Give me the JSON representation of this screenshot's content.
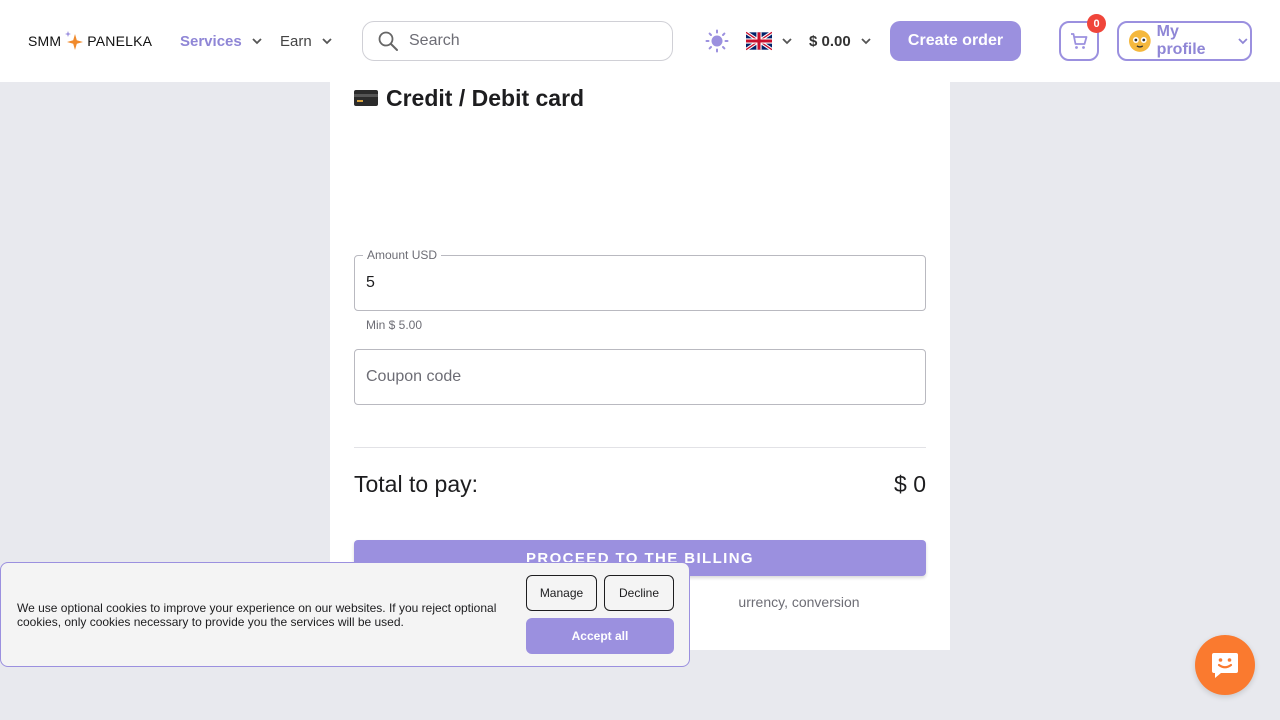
{
  "header": {
    "logo": {
      "part1": "SMM",
      "part2": "PANELKA"
    },
    "nav": [
      {
        "label": "Services",
        "active": true
      },
      {
        "label": "Earn",
        "active": false
      }
    ],
    "search": {
      "placeholder": "Search",
      "value": ""
    },
    "language": {
      "icon": "uk-flag-icon"
    },
    "balance": "$ 0.00",
    "create_order_label": "Create order",
    "cart_count": "0",
    "profile_label": "My profile"
  },
  "payment": {
    "title": "Credit / Debit card",
    "amount": {
      "legend": "Amount USD",
      "value": "5",
      "helper": "Min $ 5.00"
    },
    "coupon": {
      "placeholder": "Coupon code",
      "value": ""
    },
    "total_label": "Total to pay:",
    "total_value": "$ 0",
    "proceed_label": "PROCEED TO THE BILLING",
    "note_visible": "urrency, conversion"
  },
  "cookie_banner": {
    "text": "We use optional cookies to improve your experience on our websites. If you reject optional cookies, only cookies necessary to provide you the services will be used.",
    "manage_label": "Manage",
    "decline_label": "Decline",
    "accept_label": "Accept all"
  },
  "colors": {
    "accent": "#9b90df",
    "background": "#e8e9ee",
    "badge": "#f0453a",
    "chat": "#fa7a2f"
  }
}
